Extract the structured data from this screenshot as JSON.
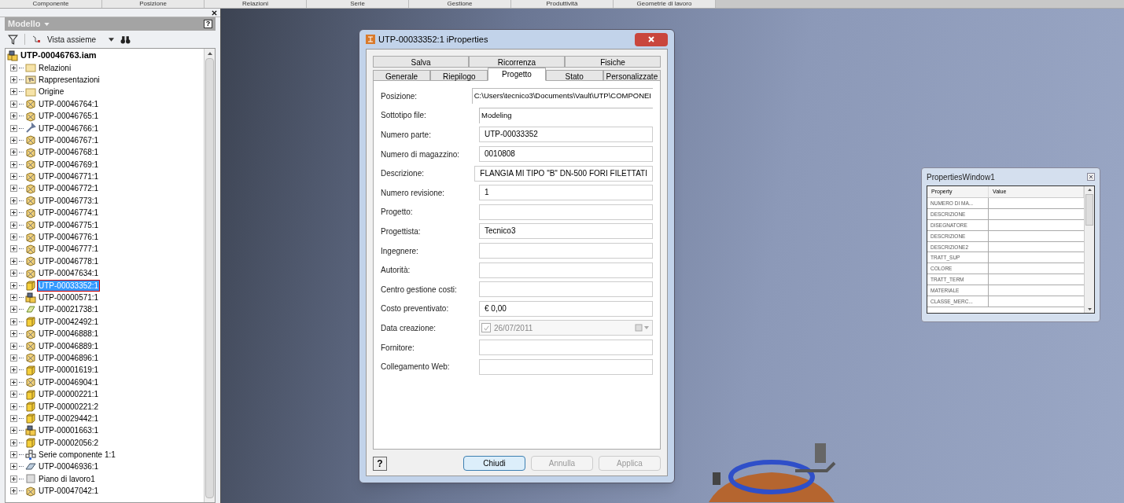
{
  "ribbon_tabs": [
    "Componente",
    "Posizione",
    "Relazioni",
    "Serie",
    "Gestione",
    "Produttività",
    "Geometrie di lavoro"
  ],
  "browser": {
    "title": "Modello",
    "help": "?",
    "view_label": "Vista assieme",
    "tree": {
      "label": "UTP-00046763.iam",
      "kind": "assembly",
      "selected": false,
      "children": [
        {
          "label": "Relazioni",
          "kind": "folder",
          "selected": false
        },
        {
          "label": "Rappresentazioni",
          "kind": "representations",
          "selected": false
        },
        {
          "label": "Origine",
          "kind": "folder",
          "selected": false
        },
        {
          "label": "UTP-00046764:1",
          "kind": "weldment",
          "selected": false
        },
        {
          "label": "UTP-00046765:1",
          "kind": "weldment",
          "selected": false
        },
        {
          "label": "UTP-00046766:1",
          "kind": "tool",
          "selected": false
        },
        {
          "label": "UTP-00046767:1",
          "kind": "weldment",
          "selected": false
        },
        {
          "label": "UTP-00046768:1",
          "kind": "weldment",
          "selected": false
        },
        {
          "label": "UTP-00046769:1",
          "kind": "weldment",
          "selected": false
        },
        {
          "label": "UTP-00046771:1",
          "kind": "weldment",
          "selected": false
        },
        {
          "label": "UTP-00046772:1",
          "kind": "weldment",
          "selected": false
        },
        {
          "label": "UTP-00046773:1",
          "kind": "weldment",
          "selected": false
        },
        {
          "label": "UTP-00046774:1",
          "kind": "weldment",
          "selected": false
        },
        {
          "label": "UTP-00046775:1",
          "kind": "weldment",
          "selected": false
        },
        {
          "label": "UTP-00046776:1",
          "kind": "weldment",
          "selected": false
        },
        {
          "label": "UTP-00046777:1",
          "kind": "weldment",
          "selected": false
        },
        {
          "label": "UTP-00046778:1",
          "kind": "weldment",
          "selected": false
        },
        {
          "label": "UTP-00047634:1",
          "kind": "weldment",
          "selected": false
        },
        {
          "label": "UTP-00033352:1",
          "kind": "part",
          "selected": true
        },
        {
          "label": "UTP-00000571:1",
          "kind": "assembly",
          "selected": false
        },
        {
          "label": "UTP-00021738:1",
          "kind": "surface",
          "selected": false
        },
        {
          "label": "UTP-00042492:1",
          "kind": "part",
          "selected": false
        },
        {
          "label": "UTP-00046888:1",
          "kind": "weldment",
          "selected": false
        },
        {
          "label": "UTP-00046889:1",
          "kind": "weldment",
          "selected": false
        },
        {
          "label": "UTP-00046896:1",
          "kind": "weldment",
          "selected": false
        },
        {
          "label": "UTP-00001619:1",
          "kind": "part",
          "selected": false
        },
        {
          "label": "UTP-00046904:1",
          "kind": "weldment",
          "selected": false
        },
        {
          "label": "UTP-00000221:1",
          "kind": "part",
          "selected": false
        },
        {
          "label": "UTP-00000221:2",
          "kind": "part",
          "selected": false
        },
        {
          "label": "UTP-00029442:1",
          "kind": "part",
          "selected": false
        },
        {
          "label": "UTP-00001663:1",
          "kind": "assembly",
          "selected": false
        },
        {
          "label": "UTP-00002056:2",
          "kind": "part",
          "selected": false
        },
        {
          "label": "Serie componente 1:1",
          "kind": "pattern",
          "selected": false
        },
        {
          "label": "UTP-00046936:1",
          "kind": "sheet",
          "selected": false
        },
        {
          "label": "Piano di lavoro1",
          "kind": "plane",
          "selected": false
        },
        {
          "label": "UTP-00047042:1",
          "kind": "weldment",
          "selected": false
        }
      ]
    }
  },
  "dialog": {
    "title": "UTP-00033352:1 iProperties",
    "help": "?",
    "tabs_back": [
      {
        "label": "Salva",
        "selected": false
      },
      {
        "label": "Ricorrenza",
        "selected": false
      },
      {
        "label": "Fisiche",
        "selected": false
      }
    ],
    "tabs_front": [
      {
        "label": "Generale",
        "selected": false
      },
      {
        "label": "Riepilogo",
        "selected": false
      },
      {
        "label": "Progetto",
        "selected": true
      },
      {
        "label": "Stato",
        "selected": false
      },
      {
        "label": "Personalizzate",
        "selected": false
      }
    ],
    "fields": [
      {
        "label": "Posizione:",
        "kind": "readonly",
        "value": "C:\\Users\\tecnico3\\Documents\\Vault\\UTP\\COMPONEI"
      },
      {
        "label": "Sottotipo file:",
        "kind": "readonly",
        "value": "Modeling"
      },
      {
        "label": "Numero parte:",
        "kind": "text",
        "value": "UTP-00033352"
      },
      {
        "label": "Numero di magazzino:",
        "kind": "text",
        "value": "0010808"
      },
      {
        "label": "Descrizione:",
        "kind": "text",
        "value": "FLANGIA MI TIPO \"B\" DN-500 FORI FILETTATI"
      },
      {
        "label": "Numero revisione:",
        "kind": "text",
        "value": "1"
      },
      {
        "label": "Progetto:",
        "kind": "text"
      },
      {
        "label": "Progettista:",
        "kind": "text",
        "value": "Tecnico3"
      },
      {
        "label": "Ingegnere:",
        "kind": "text"
      },
      {
        "label": "Autorità:",
        "kind": "text"
      },
      {
        "label": "Centro gestione costi:",
        "kind": "text"
      },
      {
        "label": "Costo preventivato:",
        "kind": "text",
        "value": "€ 0,00"
      },
      {
        "label": "Data creazione:",
        "kind": "date",
        "value": "26/07/2011",
        "checked": true,
        "disabled": true
      },
      {
        "label": "Fornitore:",
        "kind": "text"
      },
      {
        "label": "Collegamento Web:",
        "kind": "text"
      }
    ],
    "buttons": [
      {
        "label": "Chiudi",
        "disabled": false
      },
      {
        "label": "Annulla",
        "disabled": true
      },
      {
        "label": "Applica",
        "disabled": true
      }
    ]
  },
  "properties_window": {
    "title": "PropertiesWindow1",
    "columns": [
      "Property",
      "Value"
    ],
    "rows": [
      "NUMERO DI MA...",
      "DESCRIZIONE",
      "DISEGNATORE",
      "DESCRIZIONE",
      "DESCRIZIONE2",
      "TRATT_SUP",
      "COLORE",
      "TRATT_TERM",
      "MATERIALE",
      "CLASSE_MERC..."
    ]
  }
}
